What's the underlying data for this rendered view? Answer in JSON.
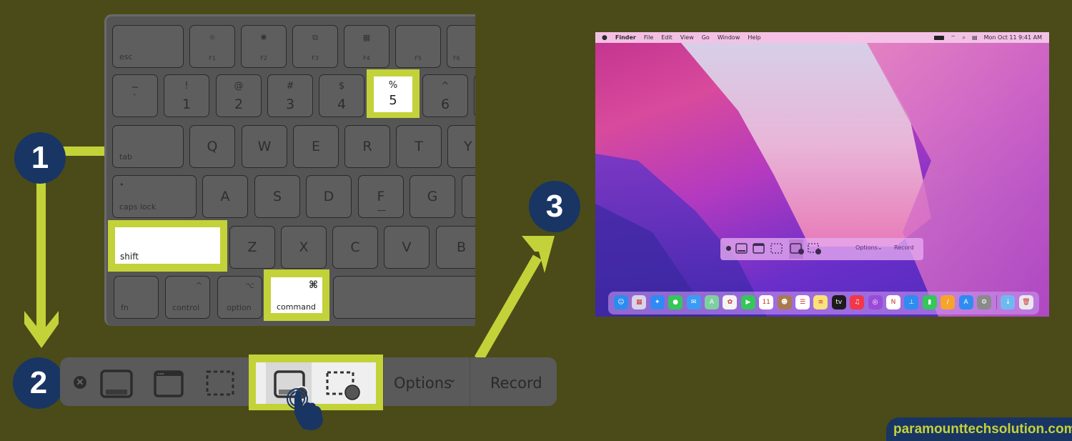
{
  "steps": [
    "1",
    "2",
    "3"
  ],
  "keyboard": {
    "function_row": [
      {
        "label": "esc",
        "icon": ""
      },
      {
        "label": "F1",
        "icon": "brightness-low-icon"
      },
      {
        "label": "F2",
        "icon": "brightness-high-icon"
      },
      {
        "label": "F3",
        "icon": "mission-control-icon"
      },
      {
        "label": "F4",
        "icon": "launchpad-icon"
      },
      {
        "label": "F5",
        "icon": ""
      },
      {
        "label": "F6",
        "icon": ""
      }
    ],
    "number_row": [
      {
        "top": "~",
        "main": "`"
      },
      {
        "top": "!",
        "main": "1"
      },
      {
        "top": "@",
        "main": "2"
      },
      {
        "top": "#",
        "main": "3"
      },
      {
        "top": "$",
        "main": "4"
      },
      {
        "top": "%",
        "main": "5",
        "highlighted": true
      },
      {
        "top": "^",
        "main": "6"
      }
    ],
    "top_row": [
      "tab",
      "Q",
      "W",
      "E",
      "R",
      "T",
      "Y"
    ],
    "home_row": [
      "caps lock",
      "A",
      "S",
      "D",
      "F",
      "G"
    ],
    "bottom_row": [
      "shift",
      "Z",
      "X",
      "C",
      "V",
      "B"
    ],
    "modifier_row": [
      {
        "label": "fn",
        "symbol": ""
      },
      {
        "label": "control",
        "symbol": "^"
      },
      {
        "label": "option",
        "symbol": "⌥"
      },
      {
        "label": "command",
        "symbol": "⌘",
        "highlighted": true
      }
    ],
    "highlighted_keys": [
      "shift",
      "command",
      "5"
    ]
  },
  "screenshot_toolbar": {
    "close_symbol": "✕",
    "tools": [
      {
        "name": "capture-entire-screen",
        "selected": false
      },
      {
        "name": "capture-selected-window",
        "selected": false
      },
      {
        "name": "capture-selected-portion",
        "selected": false
      },
      {
        "name": "record-entire-screen",
        "selected": true,
        "highlighted": true
      },
      {
        "name": "record-selected-portion",
        "selected": false,
        "highlighted": true
      }
    ],
    "options_label": "Options",
    "options_chevron": "⌄",
    "record_label": "Record"
  },
  "mac_screen": {
    "menubar": {
      "apple": "",
      "app_name": "Finder",
      "menus": [
        "File",
        "Edit",
        "View",
        "Go",
        "Window",
        "Help"
      ],
      "status_icons": [
        "battery-icon",
        "wifi-icon",
        "search-icon",
        "control-center-icon"
      ],
      "clock": "Mon Oct 11  9:41 AM"
    },
    "mini_toolbar": {
      "options_label": "Options",
      "options_chevron": "⌄",
      "record_label": "Record"
    },
    "dock": [
      {
        "name": "Finder",
        "color": "#2b8cf0",
        "glyph": "☺"
      },
      {
        "name": "Launchpad",
        "color": "#d9d4ea",
        "glyph": "▦"
      },
      {
        "name": "Safari",
        "color": "#2f8af5",
        "glyph": "✦"
      },
      {
        "name": "Messages",
        "color": "#34c759",
        "glyph": "●"
      },
      {
        "name": "Mail",
        "color": "#3b9cf5",
        "glyph": "✉"
      },
      {
        "name": "Maps",
        "color": "#7fd0a0",
        "glyph": "A"
      },
      {
        "name": "Photos",
        "color": "#f4f4f4",
        "glyph": "✿"
      },
      {
        "name": "FaceTime",
        "color": "#34c759",
        "glyph": "▶"
      },
      {
        "name": "Calendar",
        "color": "#ffffff",
        "glyph": "11"
      },
      {
        "name": "Contacts",
        "color": "#a97a4e",
        "glyph": "☻"
      },
      {
        "name": "Reminders",
        "color": "#ffffff",
        "glyph": "☰"
      },
      {
        "name": "Notes",
        "color": "#f9e27a",
        "glyph": "≡"
      },
      {
        "name": "TV",
        "color": "#1c1c1c",
        "glyph": "tv"
      },
      {
        "name": "Music",
        "color": "#f0374c",
        "glyph": "♫"
      },
      {
        "name": "Podcasts",
        "color": "#9a4bd8",
        "glyph": "◎"
      },
      {
        "name": "News",
        "color": "#ffffff",
        "glyph": "N"
      },
      {
        "name": "Keynote",
        "color": "#2f8cf0",
        "glyph": "⊥"
      },
      {
        "name": "Numbers",
        "color": "#34c759",
        "glyph": "▮"
      },
      {
        "name": "Pages",
        "color": "#f7a42b",
        "glyph": "/"
      },
      {
        "name": "App Store",
        "color": "#2f8cf0",
        "glyph": "A"
      },
      {
        "name": "System Preferences",
        "color": "#8a8a8a",
        "glyph": "⚙"
      },
      {
        "name": "Downloads",
        "color": "#6fb9f0",
        "glyph": "↓"
      },
      {
        "name": "Trash",
        "color": "#e8e8ef",
        "glyph": "🗑"
      }
    ]
  },
  "watermark": "paramounttechsolution.com",
  "colors": {
    "background": "#4a4b19",
    "accent_lime": "#c3d239",
    "badge_navy": "#193564",
    "keyboard_gray": "#555556"
  }
}
